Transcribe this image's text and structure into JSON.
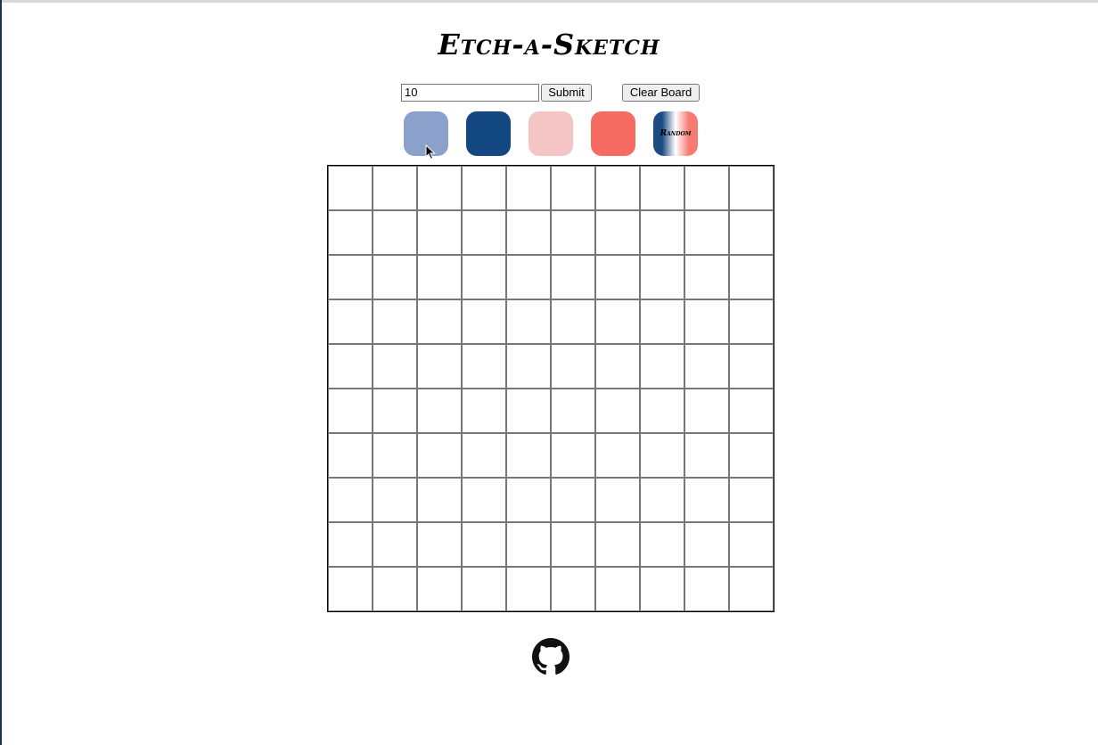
{
  "header": {
    "title": "Etch-a-Sketch"
  },
  "controls": {
    "size_value": "10",
    "submit_label": "Submit",
    "clear_label": "Clear Board"
  },
  "palette": [
    {
      "name": "light-blue",
      "color": "#8ba1cc"
    },
    {
      "name": "navy",
      "color": "#124781"
    },
    {
      "name": "light-pink",
      "color": "#f5c4c4"
    },
    {
      "name": "coral",
      "color": "#f56b62"
    },
    {
      "name": "random",
      "label": "Random",
      "gradient": [
        "#1d4b84",
        "#ffffff",
        "#f77b73"
      ]
    }
  ],
  "board": {
    "grid_size": 10,
    "cell_color": "#ffffff",
    "line_color": "#777777"
  },
  "footer": {
    "icon": "github-icon"
  }
}
